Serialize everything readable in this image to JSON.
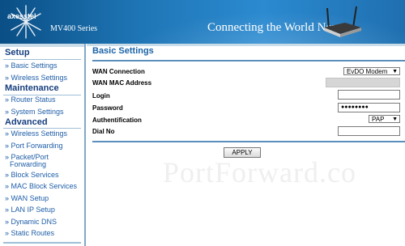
{
  "header": {
    "logo_text": "axesstel",
    "series": "MV400 Series",
    "tagline": "Connecting the World Now"
  },
  "sidebar": {
    "sections": [
      {
        "title": "Setup",
        "items": [
          "» Basic Settings",
          "» Wireless Settings"
        ]
      },
      {
        "title": "Maintenance",
        "items": [
          "» Router Status",
          "» System Settings"
        ]
      },
      {
        "title": "Advanced",
        "items": [
          "» Wireless Settings",
          "» Port Forwarding",
          "» Packet/Port",
          "Forwarding",
          "» Block Services",
          "» MAC Block Services",
          "» WAN Setup",
          "» LAN IP Setup",
          "» Dynamic DNS",
          "» Static Routes"
        ]
      }
    ]
  },
  "main": {
    "title": "Basic Settings",
    "fields": {
      "wan_connection": {
        "label": "WAN Connection",
        "value": "EvDO Modem"
      },
      "wan_mac": {
        "label": "WAN MAC Address",
        "value": ""
      },
      "login": {
        "label": "Login",
        "value": ""
      },
      "password": {
        "label": "Password",
        "value": "●●●●●●●●"
      },
      "authentication": {
        "label": "Authentification",
        "value": "PAP"
      },
      "dial_no": {
        "label": "Dial No",
        "value": ""
      }
    },
    "apply_label": "APPLY"
  },
  "watermark": "PortForward.co"
}
